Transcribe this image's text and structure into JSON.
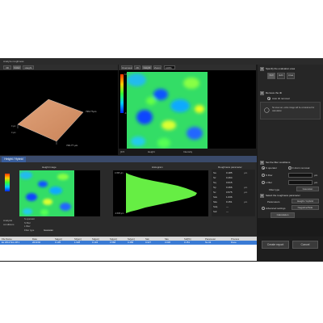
{
  "window": {
    "title": "Analyze roughness"
  },
  "left_view": {
    "toolbar": [
      "3D",
      "Color",
      "Height"
    ],
    "axis_labels": [
      "729.77µm",
      "729.77 µm"
    ],
    "z_values": [
      "0 µm",
      "0 µm"
    ]
  },
  "right_view": {
    "toolbar": [
      "Overview",
      "2D",
      "Height",
      "Zoom"
    ],
    "zoom_value": "100%",
    "footer": [
      "Height",
      "Intensity"
    ],
    "scale_labels": [
      "0.5 µm",
      "-0.5 µm"
    ],
    "zoom_label": "[0.5"
  },
  "settings": {
    "step1": {
      "num": "1",
      "title": "Specify the evaluation area",
      "buttons": [
        "Full",
        "Edit",
        "Area"
      ]
    },
    "step2": {
      "num": "2",
      "title": "Remove the tilt",
      "option": "Auto tilt removal",
      "note": "No area set, entire image will be considered for calculation"
    },
    "step3": {
      "num": "3",
      "title": "Set the filter conditions",
      "options": [
        "S operator",
        "S filter",
        "L filter"
      ],
      "operator_choice": "F-Form removal",
      "values": [
        "µm",
        "µm"
      ],
      "filter_type_label": "Filter type",
      "filter_type_value": "Gaussian"
    },
    "step4": {
      "num": "4",
      "title": "Select the roughness parameter",
      "param_label": "Parameters",
      "param_value": "Height / Hybrid",
      "advanced_label": "Advanced settings",
      "advanced_value": "Negative/Side"
    },
    "calc_button": "Calculation"
  },
  "mid_section": {
    "tab": "Height / Hybrid",
    "height_image_title": "Height image",
    "histogram_title": "Histogram",
    "roughness_title": "Roughness parameter",
    "hist_labels": [
      "0.395 µm",
      "0.308 µm",
      "-0.395 µm"
    ],
    "info": [
      {
        "label": "S operator",
        "value": ""
      },
      {
        "label": "S filter",
        "value": ""
      },
      {
        "label": "L filter",
        "value": ""
      },
      {
        "label": "Filter type",
        "value": "Gaussian"
      }
    ],
    "info_prefix": [
      "Analysis",
      "conditions"
    ],
    "roughness_params": [
      {
        "name": "Sa",
        "value": "0.185",
        "unit": "µm"
      },
      {
        "name": "Sz",
        "value": "0.464",
        "unit": ""
      },
      {
        "name": "Sq",
        "value": "0.615",
        "unit": ""
      },
      {
        "name": "Sp",
        "value": "0.466",
        "unit": "µm"
      },
      {
        "name": "Sv",
        "value": "0.575",
        "unit": "µm"
      },
      {
        "name": "Ssk",
        "value": "1.036",
        "unit": ""
      },
      {
        "name": "Sku",
        "value": "0.151",
        "unit": "µm"
      },
      {
        "name": "Sdq",
        "value": "---",
        "unit": ""
      },
      {
        "name": "Sdr",
        "value": "---",
        "unit": ""
      }
    ]
  },
  "results_table": {
    "headers": [
      "File Name",
      "Date",
      "Sa[µm]",
      "Sz[µm]",
      "Sq[µm]",
      "Sp[µm]",
      "Sv[µm]",
      "Ssk",
      "Sku",
      "Sdr[%]",
      "Parameter",
      "Process"
    ],
    "rows": [
      [
        "Ex 2012 Nov 28 1",
        "2013/02",
        "0.105",
        "1.028",
        "0.134",
        "0.568",
        "0.458",
        "0.027",
        "3.036",
        "0.151",
        "No tilt",
        "Done"
      ]
    ]
  },
  "actions": {
    "create_report": "Create report",
    "cancel": "Cancel"
  },
  "colors": {
    "accent_blue": "#3399ff",
    "selected_row": "#3a7bd5",
    "histogram_green": "#66ee44"
  }
}
